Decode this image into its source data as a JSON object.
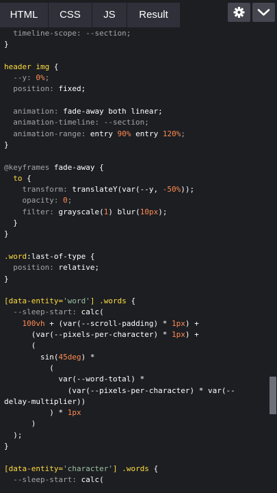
{
  "tabs": {
    "html": "HTML",
    "css": "CSS",
    "js": "JS",
    "result": "Result"
  },
  "toolbar": {
    "settings_icon": "gear-icon",
    "collapse_icon": "chevron-down-icon"
  },
  "code_lines": [
    [
      [
        "c",
        "  timeline-scope: --section;"
      ]
    ],
    [
      [
        "w",
        "}"
      ]
    ],
    [
      [
        "w",
        ""
      ]
    ],
    [
      [
        "y",
        "header img "
      ],
      [
        "w",
        "{"
      ]
    ],
    [
      [
        "c",
        "  --y: "
      ],
      [
        "o",
        "0%"
      ],
      [
        "c",
        ";"
      ]
    ],
    [
      [
        "c",
        "  position: "
      ],
      [
        "w",
        "fixed;"
      ]
    ],
    [
      [
        "w",
        ""
      ]
    ],
    [
      [
        "c",
        "  animation: "
      ],
      [
        "w",
        "fade-away both linear;"
      ]
    ],
    [
      [
        "c",
        "  animation-timeline: --section;"
      ]
    ],
    [
      [
        "c",
        "  animation-range: "
      ],
      [
        "w",
        "entry "
      ],
      [
        "o",
        "90%"
      ],
      [
        "w",
        " entry "
      ],
      [
        "o",
        "120%"
      ],
      [
        "c",
        ";"
      ]
    ],
    [
      [
        "w",
        "}"
      ]
    ],
    [
      [
        "w",
        ""
      ]
    ],
    [
      [
        "c",
        "@keyframes "
      ],
      [
        "w",
        "fade-away {"
      ]
    ],
    [
      [
        "y",
        "  to "
      ],
      [
        "w",
        "{"
      ]
    ],
    [
      [
        "c",
        "    transform: "
      ],
      [
        "w",
        "translateY(var(--y, "
      ],
      [
        "o",
        "-50%"
      ],
      [
        "w",
        "));"
      ]
    ],
    [
      [
        "c",
        "    opacity: "
      ],
      [
        "o",
        "0"
      ],
      [
        "c",
        ";"
      ]
    ],
    [
      [
        "c",
        "    filter: "
      ],
      [
        "w",
        "grayscale("
      ],
      [
        "o",
        "1"
      ],
      [
        "w",
        ") blur("
      ],
      [
        "o",
        "10px"
      ],
      [
        "w",
        ");"
      ]
    ],
    [
      [
        "w",
        "  }"
      ]
    ],
    [
      [
        "w",
        "}"
      ]
    ],
    [
      [
        "w",
        ""
      ]
    ],
    [
      [
        "y",
        ".word"
      ],
      [
        "w",
        ":last-of-type {"
      ]
    ],
    [
      [
        "c",
        "  position: "
      ],
      [
        "w",
        "relative;"
      ]
    ],
    [
      [
        "w",
        "}"
      ]
    ],
    [
      [
        "w",
        ""
      ]
    ],
    [
      [
        "y",
        "[data-entity="
      ],
      [
        "s",
        "'word'"
      ],
      [
        "y",
        "] .words "
      ],
      [
        "w",
        "{"
      ]
    ],
    [
      [
        "c",
        "  --sleep-start: "
      ],
      [
        "w",
        "calc("
      ]
    ],
    [
      [
        "o",
        "    100vh "
      ],
      [
        "w",
        "+ (var(--scroll-padding) * "
      ],
      [
        "o",
        "1px"
      ],
      [
        "w",
        ") +"
      ]
    ],
    [
      [
        "w",
        "      (var(--pixels-per-character) * "
      ],
      [
        "o",
        "1px"
      ],
      [
        "w",
        ") +"
      ]
    ],
    [
      [
        "w",
        "      ("
      ]
    ],
    [
      [
        "w",
        "        sin("
      ],
      [
        "o",
        "45deg"
      ],
      [
        "w",
        ") *"
      ]
    ],
    [
      [
        "w",
        "          ("
      ]
    ],
    [
      [
        "w",
        "            var(--word-total) *"
      ]
    ],
    [
      [
        "w",
        "              (var(--pixels-per-character) * var(--"
      ]
    ],
    [
      [
        "w",
        "delay-multiplier))"
      ]
    ],
    [
      [
        "w",
        "          ) * "
      ],
      [
        "o",
        "1px"
      ]
    ],
    [
      [
        "w",
        "      )"
      ]
    ],
    [
      [
        "w",
        "  );"
      ]
    ],
    [
      [
        "w",
        "}"
      ]
    ],
    [
      [
        "w",
        ""
      ]
    ],
    [
      [
        "y",
        "[data-entity="
      ],
      [
        "s",
        "'character'"
      ],
      [
        "y",
        "] .words "
      ],
      [
        "w",
        "{"
      ]
    ],
    [
      [
        "c",
        "  --sleep-start: "
      ],
      [
        "w",
        "calc("
      ]
    ],
    [
      [
        "w",
        ""
      ]
    ]
  ],
  "colors": {
    "background": "#1d1e22",
    "tab_bg": "#2f3039",
    "button_bg": "#45464f",
    "selector": "#ffdd40",
    "number": "#fe8b50",
    "string": "#9cc0a2",
    "muted": "#a5a5a5"
  }
}
